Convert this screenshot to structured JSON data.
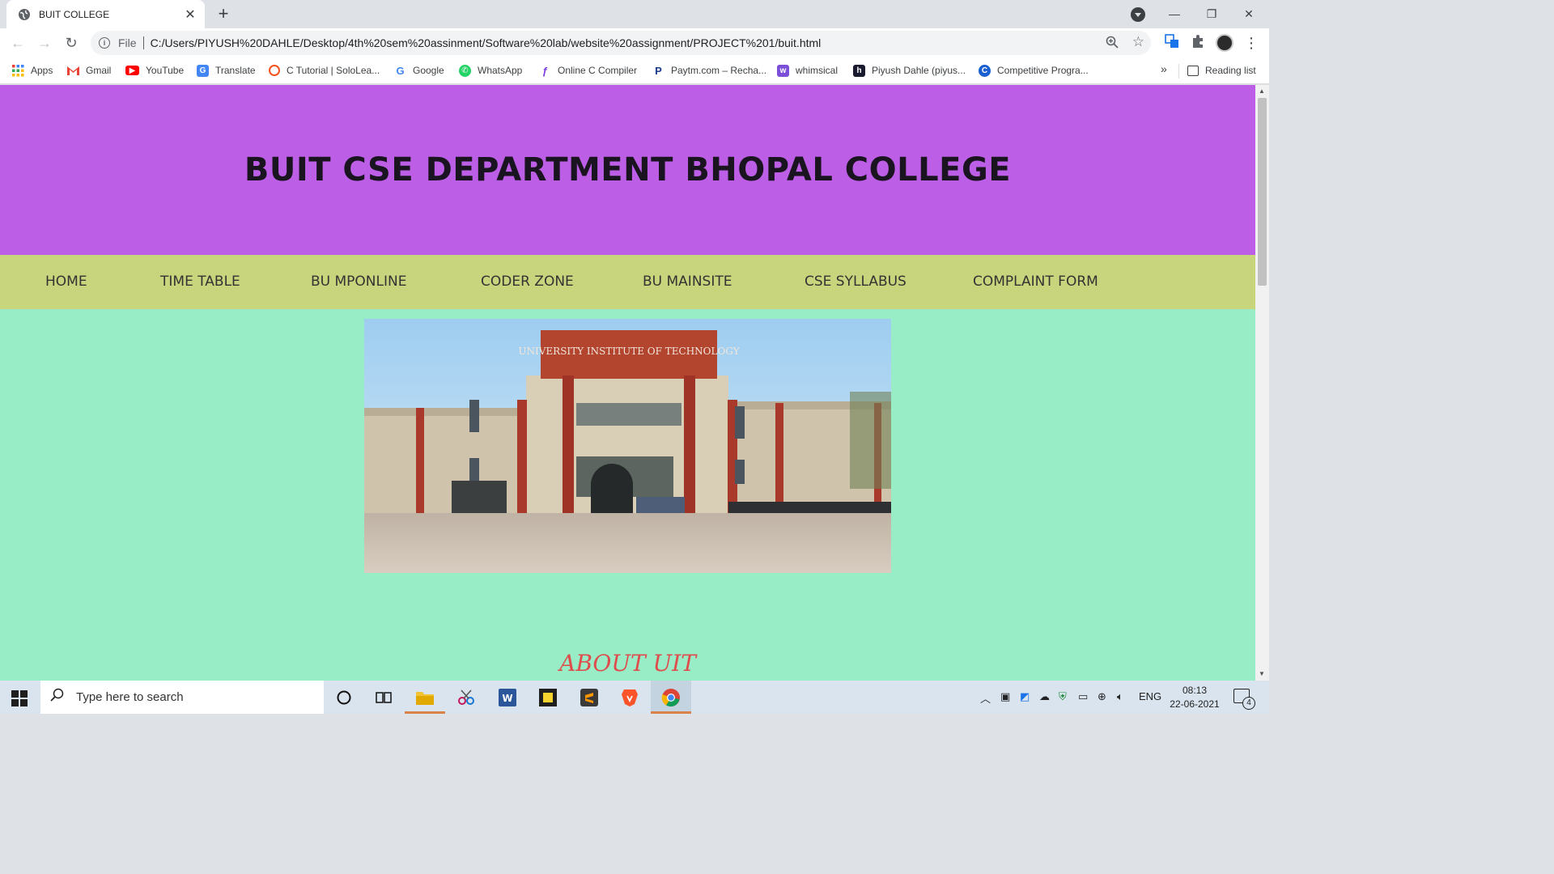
{
  "tab": {
    "title": "BUIT COLLEGE"
  },
  "omnibox": {
    "scheme": "File",
    "url": "C:/Users/PIYUSH%20DAHLE/Desktop/4th%20sem%20assinment/Software%20lab/website%20assignment/PROJECT%201/buit.html"
  },
  "bookmarks": [
    {
      "label": "Apps",
      "icon": "apps-grid-icon"
    },
    {
      "label": "Gmail",
      "icon": "gmail-icon"
    },
    {
      "label": "YouTube",
      "icon": "youtube-icon"
    },
    {
      "label": "Translate",
      "icon": "translate-icon"
    },
    {
      "label": "C Tutorial | SoloLea...",
      "icon": "sololearn-icon"
    },
    {
      "label": "Google",
      "icon": "google-icon"
    },
    {
      "label": "WhatsApp",
      "icon": "whatsapp-icon"
    },
    {
      "label": "Online C Compiler",
      "icon": "compiler-icon"
    },
    {
      "label": "Paytm.com – Recha...",
      "icon": "paytm-icon"
    },
    {
      "label": "whimsical",
      "icon": "whimsical-icon"
    },
    {
      "label": "Piyush Dahle (piyus...",
      "icon": "hashnode-icon"
    },
    {
      "label": "Competitive Progra...",
      "icon": "competitive-icon"
    }
  ],
  "bookmarks_more": "»",
  "reading_list": "Reading list",
  "site": {
    "title": "BUIT CSE DEPARTMENT BHOPAL COLLEGE",
    "nav": [
      "HOME",
      "TIME TABLE",
      "BU MPONLINE",
      "CODER ZONE",
      "BU MAINSITE",
      "CSE SYLLABUS",
      "COMPLAINT FORM"
    ],
    "building_sign": "UNIVERSITY INSTITUTE OF TECHNOLOGY",
    "about_heading": "ABOUT UIT"
  },
  "taskbar": {
    "search_placeholder": "Type here to search",
    "language": "ENG",
    "time": "08:13",
    "date": "22-06-2021",
    "notification_count": "4"
  },
  "colors": {
    "header_bg": "#bc5fe6",
    "nav_bg": "#c9d57c",
    "page_bg": "#98ecc6",
    "about_color": "#e04b4b"
  }
}
